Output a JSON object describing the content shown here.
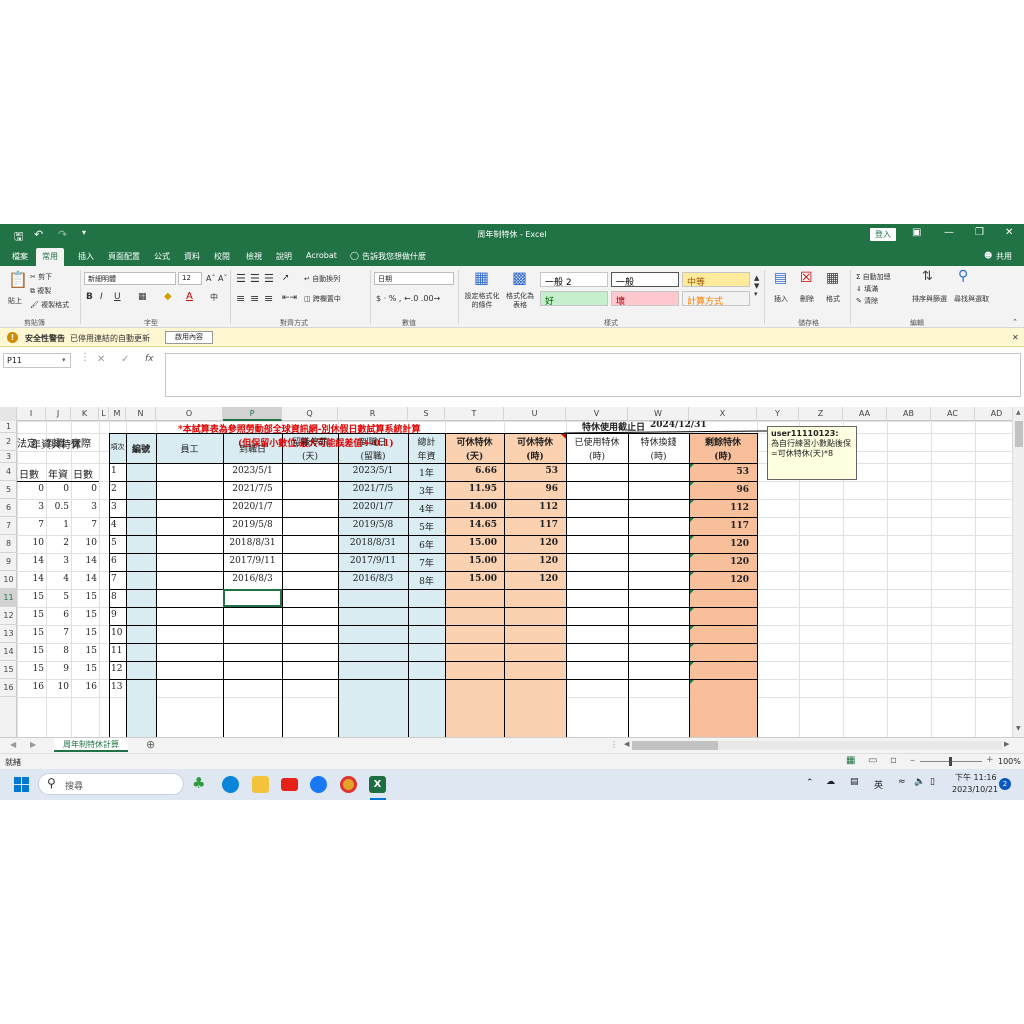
{
  "window": {
    "title": "周年制特休 - Excel",
    "login_label": "登入",
    "share_label": "共用"
  },
  "menu": [
    "檔案",
    "常用",
    "插入",
    "頁面配置",
    "公式",
    "資料",
    "校閱",
    "檢視",
    "說明",
    "Acrobat",
    "告訴我您想做什麼"
  ],
  "ribbon": {
    "clipboard": {
      "paste": "貼上",
      "cut": "剪下",
      "copy": "複製",
      "format_painter": "複製格式",
      "label": "剪貼簿"
    },
    "font": {
      "name": "新細明體",
      "size": "12",
      "label": "字型"
    },
    "alignment": {
      "wrap": "自動換列",
      "merge": "跨欄置中",
      "label": "對齊方式"
    },
    "number": {
      "format": "日期",
      "label": "數值"
    },
    "styles": {
      "conditional": "設定格式化的條件",
      "as_table": "格式化為表格",
      "cells": [
        {
          "text": "一般 2",
          "bg": "#ffffff",
          "fg": "#000000"
        },
        {
          "text": "一般",
          "bg": "#ffffff",
          "fg": "#000000"
        },
        {
          "text": "中等",
          "bg": "#ffeb9c",
          "fg": "#9c5700"
        },
        {
          "text": "好",
          "bg": "#c6efce",
          "fg": "#006100"
        },
        {
          "text": "壞",
          "bg": "#ffc7ce",
          "fg": "#9c0006"
        },
        {
          "text": "計算方式",
          "bg": "#f2f2f2",
          "fg": "#fa7d00"
        }
      ],
      "label": "樣式"
    },
    "cells_group": {
      "insert": "插入",
      "delete": "刪除",
      "format": "格式",
      "label": "儲存格"
    },
    "editing": {
      "autosum": "自動加總",
      "fill": "填滿",
      "clear": "清除",
      "sort": "排序與篩選",
      "find": "尋找與選取",
      "label": "編輯"
    }
  },
  "security_bar": {
    "title": "安全性警告",
    "message": "已停用連結的自動更新",
    "button": "啟用內容"
  },
  "formula_bar": {
    "name_box": "P11",
    "formula": ""
  },
  "columns": [
    "I",
    "J",
    "K",
    "L",
    "M",
    "N",
    "O",
    "P",
    "Q",
    "R",
    "S",
    "T",
    "U",
    "V",
    "W",
    "X",
    "Y",
    "Z",
    "AA",
    "AB",
    "AC",
    "AD"
  ],
  "rows": [
    "1",
    "2",
    "3",
    "4",
    "5",
    "6",
    "7",
    "8",
    "9",
    "10",
    "11",
    "12",
    "13",
    "14",
    "15",
    "16"
  ],
  "sheet": {
    "notice_line1": "*本試算表為參照勞動部全球資訊網-別休假日數試算系統計算",
    "notice_line2": "(但保留小數位,最大可能誤差值+-0.1)",
    "deadline_label": "特休使用截止日",
    "deadline_value": "2024/12/31",
    "side_title": "年資與特休",
    "side_headers": [
      "法定",
      "到職",
      "實際"
    ],
    "side_subheaders": [
      "日數",
      "年資",
      "日數"
    ],
    "side_rows": [
      [
        "0",
        "0",
        "0"
      ],
      [
        "3",
        "0.5",
        "3"
      ],
      [
        "7",
        "1",
        "7"
      ],
      [
        "10",
        "2",
        "10"
      ],
      [
        "14",
        "3",
        "14"
      ],
      [
        "14",
        "4",
        "14"
      ],
      [
        "15",
        "5",
        "15"
      ],
      [
        "15",
        "6",
        "15"
      ],
      [
        "15",
        "7",
        "15"
      ],
      [
        "15",
        "8",
        "15"
      ],
      [
        "15",
        "9",
        "15"
      ],
      [
        "16",
        "10",
        "16"
      ]
    ],
    "headers": {
      "seq": "項次",
      "id": "編號",
      "employee": "員工",
      "hire_date": "到職日",
      "unpaid_leave": "留職停薪",
      "unpaid_leave_unit": "(天)",
      "adj_hire_date": "到職日",
      "adj_hire_date_note": "(留職)",
      "total": "總計",
      "total2": "年資",
      "avail_days": "可休特休",
      "avail_days_unit": "(天)",
      "avail_hours": "可休特休",
      "avail_hours_unit": "(時)",
      "used": "已使用特休",
      "used_unit": "(時)",
      "converted": "特休換錢",
      "converted_unit": "(時)",
      "remaining": "剩餘特休",
      "remaining_unit": "(時)"
    },
    "records": [
      {
        "seq": "1",
        "hire": "2023/5/1",
        "adj": "2023/5/1",
        "years": "1年",
        "days": "6.66",
        "hours": "53",
        "remain": "53"
      },
      {
        "seq": "2",
        "hire": "2021/7/5",
        "adj": "2021/7/5",
        "years": "3年",
        "days": "11.95",
        "hours": "96",
        "remain": "96"
      },
      {
        "seq": "3",
        "hire": "2020/1/7",
        "adj": "2020/1/7",
        "years": "4年",
        "days": "14.00",
        "hours": "112",
        "remain": "112"
      },
      {
        "seq": "4",
        "hire": "2019/5/8",
        "adj": "2019/5/8",
        "years": "5年",
        "days": "14.65",
        "hours": "117",
        "remain": "117"
      },
      {
        "seq": "5",
        "hire": "2018/8/31",
        "adj": "2018/8/31",
        "years": "6年",
        "days": "15.00",
        "hours": "120",
        "remain": "120"
      },
      {
        "seq": "6",
        "hire": "2017/9/11",
        "adj": "2017/9/11",
        "years": "7年",
        "days": "15.00",
        "hours": "120",
        "remain": "120"
      },
      {
        "seq": "7",
        "hire": "2016/8/3",
        "adj": "2016/8/3",
        "years": "8年",
        "days": "15.00",
        "hours": "120",
        "remain": "120"
      }
    ],
    "empty_seqs": [
      "8",
      "9",
      "10",
      "11",
      "12",
      "13"
    ],
    "comment": {
      "author": "user11110123:",
      "line1": "為自行練習小數點後保",
      "line2": "=可休特休(天)*8"
    }
  },
  "sheet_tab": "周年制特休計算",
  "status": {
    "ready": "就緒",
    "zoom": "100%"
  },
  "taskbar": {
    "search_placeholder": "搜尋",
    "time": "下午 11:16",
    "date": "2023/10/21",
    "ime": "英",
    "notification_count": "2"
  },
  "colors": {
    "excel_green": "#217346",
    "blue_fill": "#d9ecf2",
    "orange_fill": "#fbd2b1",
    "remain_fill": "#f8c09a",
    "notice_red": "#e00000"
  }
}
